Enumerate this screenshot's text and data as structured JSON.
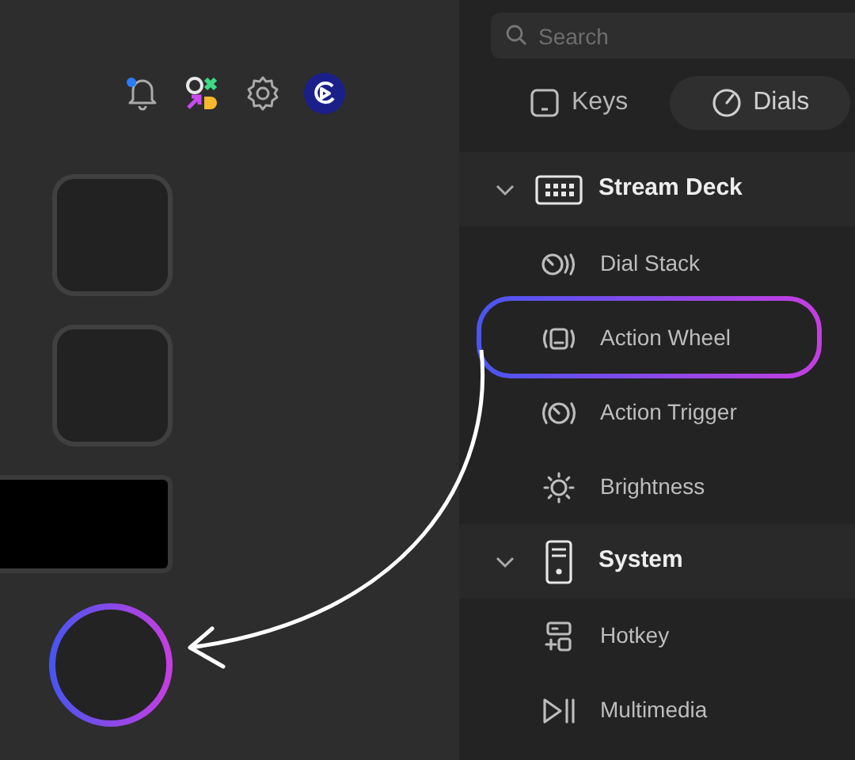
{
  "toolbar": {
    "notification": true
  },
  "slots": [
    {
      "kind": "key"
    },
    {
      "kind": "key"
    },
    {
      "kind": "screen"
    },
    {
      "kind": "dial",
      "highlighted": true
    }
  ],
  "search": {
    "placeholder": "Search"
  },
  "tabs": [
    {
      "label": "Keys",
      "kind": "keys",
      "selected": false
    },
    {
      "label": "Dials",
      "kind": "dials",
      "selected": true
    }
  ],
  "sections": [
    {
      "title": "Stream Deck",
      "kind": "deck",
      "expanded": true,
      "items": [
        {
          "label": "Dial Stack",
          "kind": "stack",
          "highlighted": false
        },
        {
          "label": "Action Wheel",
          "kind": "wheel",
          "highlighted": true
        },
        {
          "label": "Action Trigger",
          "kind": "trigger",
          "highlighted": false
        },
        {
          "label": "Brightness",
          "kind": "brightness",
          "highlighted": false
        }
      ]
    },
    {
      "title": "System",
      "kind": "system",
      "expanded": true,
      "items": [
        {
          "label": "Hotkey",
          "kind": "hotkey",
          "highlighted": false
        },
        {
          "label": "Multimedia",
          "kind": "media",
          "highlighted": false
        }
      ]
    }
  ]
}
